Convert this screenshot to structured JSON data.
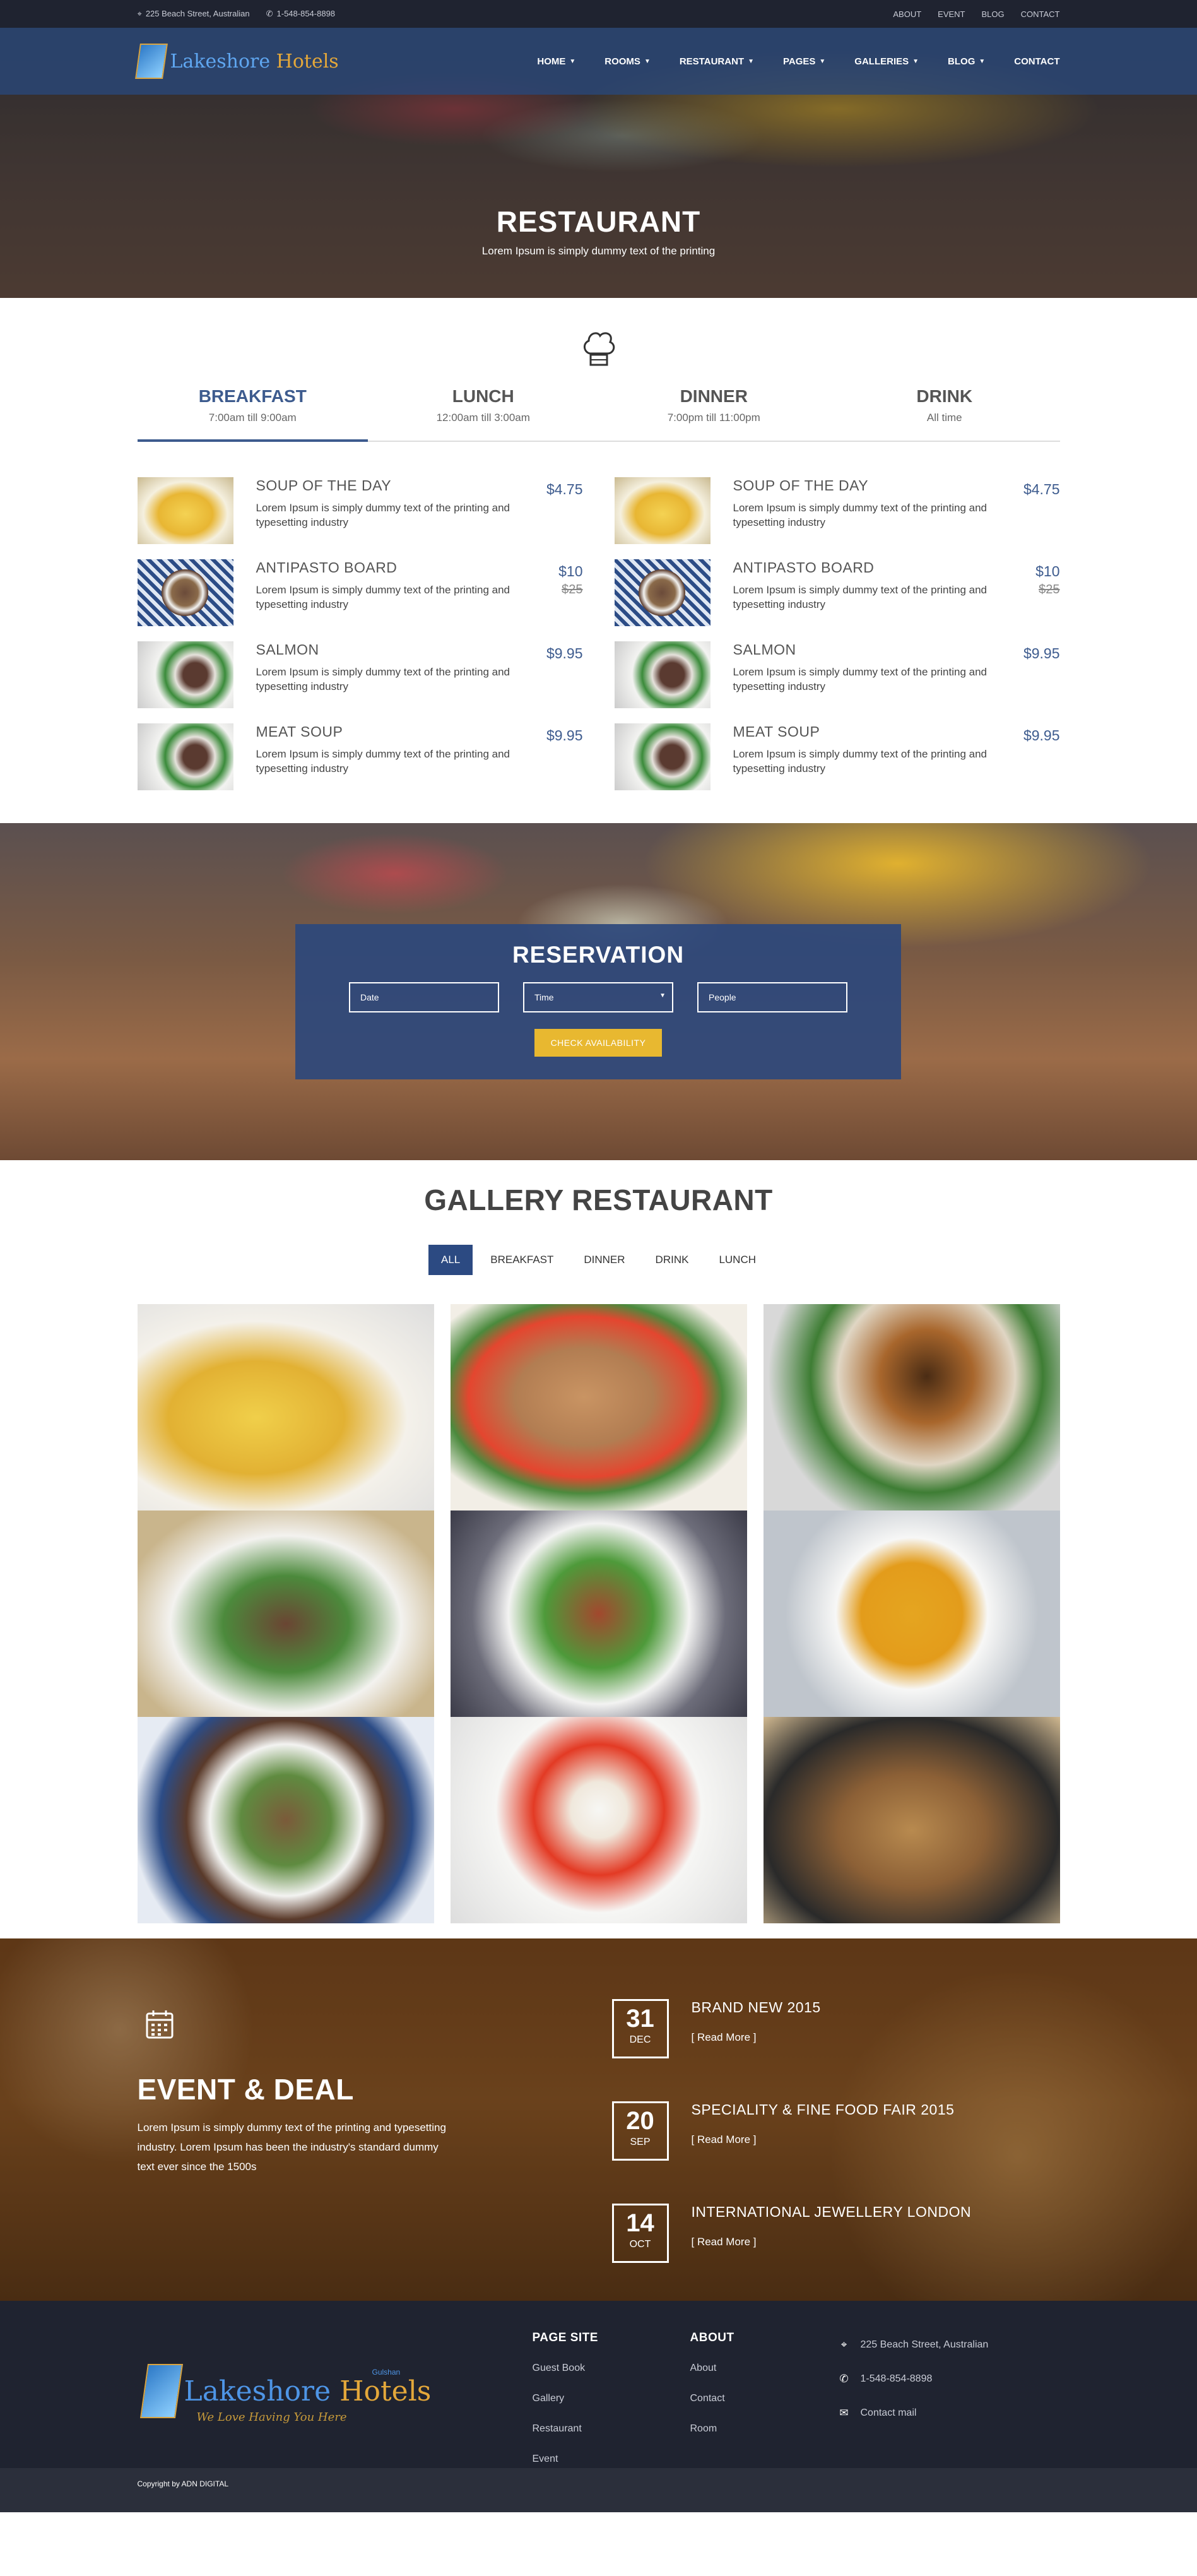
{
  "topbar": {
    "address": "225 Beach Street, Australian",
    "phone": "1-548-854-8898",
    "links": [
      "ABOUT",
      "EVENT",
      "BLOG",
      "CONTACT"
    ]
  },
  "logo": {
    "first": "Lakeshore",
    "second": "Hotels"
  },
  "nav": [
    {
      "label": "HOME",
      "dropdown": true
    },
    {
      "label": "ROOMS",
      "dropdown": true
    },
    {
      "label": "RESTAURANT",
      "dropdown": true
    },
    {
      "label": "PAGES",
      "dropdown": true
    },
    {
      "label": "GALLERIES",
      "dropdown": true
    },
    {
      "label": "BLOG",
      "dropdown": true
    },
    {
      "label": "CONTACT",
      "dropdown": false
    }
  ],
  "hero": {
    "title": "RESTAURANT",
    "subtitle": "Lorem Ipsum is simply dummy text of the printing"
  },
  "menu_tabs": [
    {
      "name": "BREAKFAST",
      "time": "7:00am till 9:00am",
      "active": true
    },
    {
      "name": "LUNCH",
      "time": "12:00am till 3:00am",
      "active": false
    },
    {
      "name": "DINNER",
      "time": "7:00pm till 11:00pm",
      "active": false
    },
    {
      "name": "DRINK",
      "time": "All time",
      "active": false
    }
  ],
  "dishes": [
    {
      "name": "SOUP OF THE DAY",
      "desc": "Lorem Ipsum is simply dummy text of the printing and typesetting industry",
      "price": "$4.75",
      "old_price": "",
      "image": "pasta"
    },
    {
      "name": "ANTIPASTO BOARD",
      "desc": "Lorem Ipsum is simply dummy text of the printing and typesetting industry",
      "price": "$10",
      "old_price": "$25",
      "image": "board"
    },
    {
      "name": "SALMON",
      "desc": "Lorem Ipsum is simply dummy text of the printing and typesetting industry",
      "price": "$9.95",
      "old_price": "",
      "image": "salmon"
    },
    {
      "name": "MEAT SOUP",
      "desc": "Lorem Ipsum is simply dummy text of the printing and typesetting industry",
      "price": "$9.95",
      "old_price": "",
      "image": "meat"
    }
  ],
  "reservation": {
    "title": "RESERVATION",
    "date_placeholder": "Date",
    "time_label": "Time",
    "people_placeholder": "People",
    "button": "CHECK AVAILABILITY"
  },
  "gallery": {
    "title": "GALLERY RESTAURANT",
    "filters": [
      "ALL",
      "BREAKFAST",
      "DINNER",
      "DRINK",
      "LUNCH"
    ],
    "active_filter": "ALL"
  },
  "event": {
    "title": "EVENT & DEAL",
    "desc": "Lorem Ipsum is simply dummy text of the printing and typesetting industry. Lorem Ipsum has been the industry's standard dummy text ever since the 1500s",
    "items": [
      {
        "day": "31",
        "month": "DEC",
        "name": "BRAND NEW 2015",
        "link": "[ Read More ]"
      },
      {
        "day": "20",
        "month": "SEP",
        "name": "SPECIALITY & FINE FOOD FAIR 2015",
        "link": "[ Read More ]"
      },
      {
        "day": "14",
        "month": "OCT",
        "name": "INTERNATIONAL JEWELLERY LONDON",
        "link": "[ Read More ]"
      }
    ]
  },
  "footer": {
    "logo_city": "Gulshan",
    "logo_tagline": "We Love Having You Here",
    "page_site": {
      "title": "PAGE SITE",
      "links": [
        "Guest Book",
        "Gallery",
        "Restaurant",
        "Event"
      ]
    },
    "about": {
      "title": "ABOUT",
      "links": [
        "About",
        "Contact",
        "Room"
      ]
    },
    "contact": {
      "address": "225 Beach Street, Australian",
      "phone": "1-548-854-8898",
      "mail": "Contact mail"
    },
    "copyright": "Copyright by ADN DIGITAL"
  }
}
